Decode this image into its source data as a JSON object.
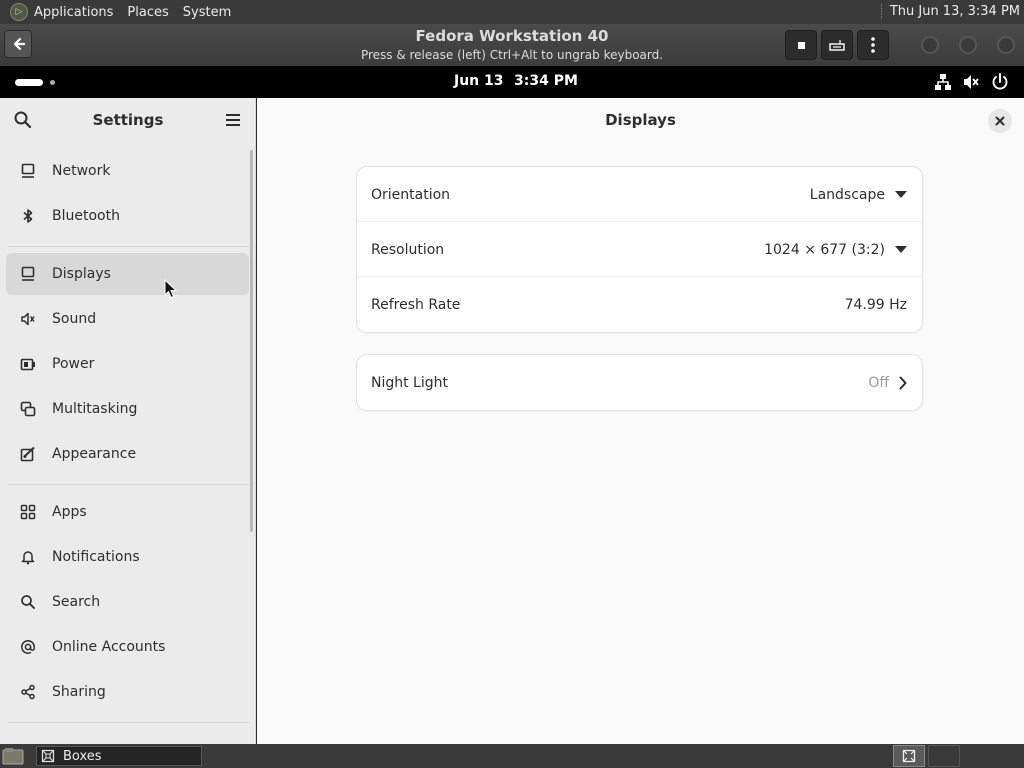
{
  "host_panel": {
    "menus": [
      "Applications",
      "Places",
      "System"
    ],
    "clock": "Thu Jun 13,  3:34 PM"
  },
  "boxes": {
    "title": "Fedora Workstation 40",
    "subtitle": "Press & release (left) Ctrl+Alt to ungrab keyboard."
  },
  "guest_bar": {
    "date": "Jun 13",
    "time": "3:34 PM"
  },
  "sidebar": {
    "title": "Settings",
    "items": [
      {
        "label": "Network",
        "icon": "network-icon"
      },
      {
        "label": "Bluetooth",
        "icon": "bluetooth-icon"
      },
      {
        "label": "Displays",
        "icon": "display-icon",
        "selected": true
      },
      {
        "label": "Sound",
        "icon": "sound-icon"
      },
      {
        "label": "Power",
        "icon": "power-icon"
      },
      {
        "label": "Multitasking",
        "icon": "multitasking-icon"
      },
      {
        "label": "Appearance",
        "icon": "appearance-icon"
      },
      {
        "label": "Apps",
        "icon": "apps-icon"
      },
      {
        "label": "Notifications",
        "icon": "bell-icon"
      },
      {
        "label": "Search",
        "icon": "search-icon"
      },
      {
        "label": "Online Accounts",
        "icon": "at-icon"
      },
      {
        "label": "Sharing",
        "icon": "share-icon"
      }
    ]
  },
  "main": {
    "title": "Displays",
    "display_settings": {
      "orientation_label": "Orientation",
      "orientation_value": "Landscape",
      "resolution_label": "Resolution",
      "resolution_value": "1024 × 677 (3:2)",
      "refresh_label": "Refresh Rate",
      "refresh_value": "74.99 Hz"
    },
    "night_light": {
      "label": "Night Light",
      "value": "Off"
    }
  },
  "taskbar": {
    "task_label": "Boxes"
  }
}
